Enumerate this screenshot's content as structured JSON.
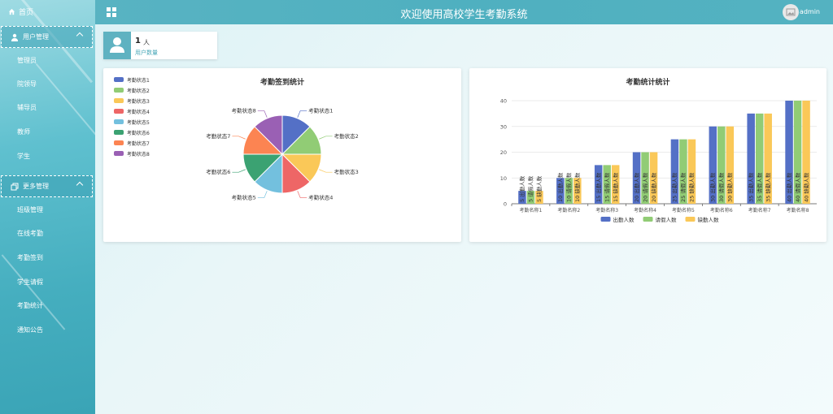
{
  "header": {
    "title": "欢迎使用高校学生考勤系统",
    "user": "admin"
  },
  "sidebar": {
    "home": "首页",
    "groups": [
      {
        "label": "用户管理",
        "items": [
          "管理员",
          "院领导",
          "辅导员",
          "教师",
          "学生"
        ]
      },
      {
        "label": "更多管理",
        "items": [
          "班级管理",
          "在线考勤",
          "考勤签到",
          "学生请假",
          "考勤统计",
          "通知公告"
        ]
      }
    ]
  },
  "user_card": {
    "count": "1",
    "unit": "人",
    "label": "用户数量"
  },
  "colors": {
    "palette": [
      "#5470c6",
      "#91cc75",
      "#fac858",
      "#ee6666",
      "#73c0de",
      "#3ba272",
      "#fc8452",
      "#9a60b4"
    ],
    "accent": "#5fb2c1"
  },
  "chart_data": [
    {
      "type": "pie",
      "title": "考勤签到统计",
      "labels": [
        "考勤状态1",
        "考勤状态2",
        "考勤状态3",
        "考勤状态4",
        "考勤状态5",
        "考勤状态6",
        "考勤状态7",
        "考勤状态8"
      ],
      "values": [
        1,
        1,
        1,
        1,
        1,
        1,
        1,
        1
      ],
      "legend": "top-left"
    },
    {
      "type": "bar",
      "title": "考勤统计统计",
      "categories": [
        "考勤名称1",
        "考勤名称2",
        "考勤名称3",
        "考勤名称4",
        "考勤名称5",
        "考勤名称6",
        "考勤名称7",
        "考勤名称8"
      ],
      "series": [
        {
          "name": "出勤人数",
          "values": [
            5,
            10,
            15,
            20,
            25,
            30,
            35,
            40
          ]
        },
        {
          "name": "请假人数",
          "values": [
            5,
            10,
            15,
            20,
            25,
            30,
            35,
            40
          ]
        },
        {
          "name": "缺勤人数",
          "values": [
            5,
            10,
            15,
            20,
            25,
            30,
            35,
            40
          ]
        }
      ],
      "yticks": [
        "0",
        "10",
        "20",
        "30",
        "40"
      ],
      "ylim": [
        0,
        40
      ],
      "legend": "bottom"
    }
  ]
}
